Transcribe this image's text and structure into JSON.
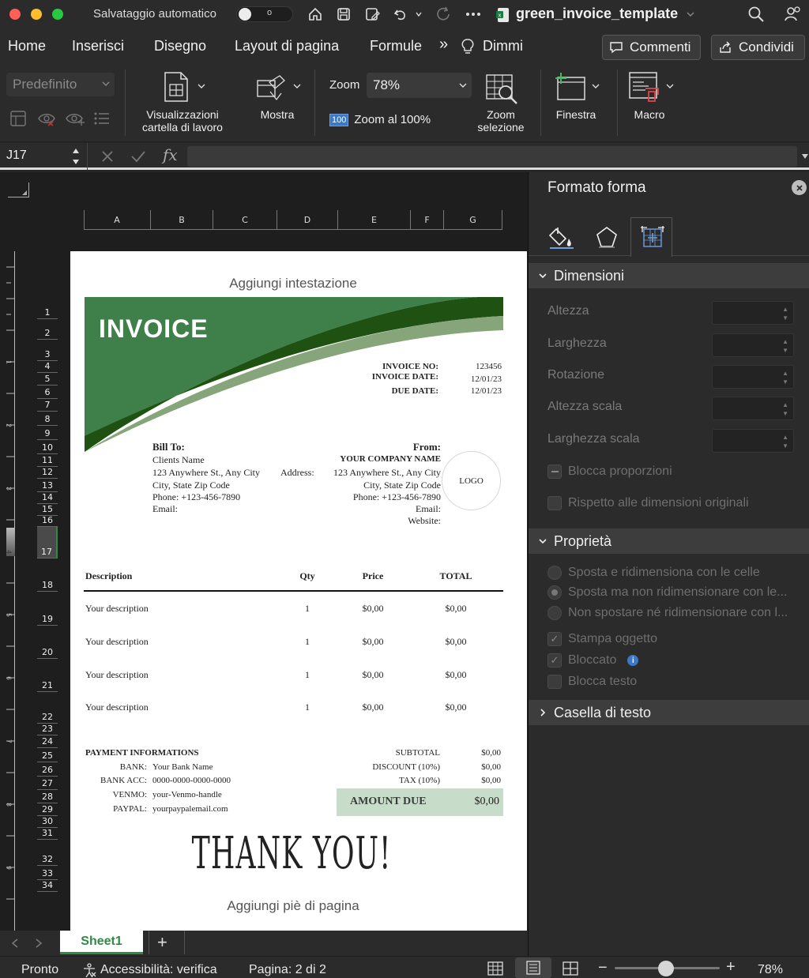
{
  "titlebar": {
    "autosave_label": "Salvataggio automatico",
    "autosave_state": "o",
    "document_title": "green_invoice_template"
  },
  "menubar": {
    "tabs": [
      "Home",
      "Inserisci",
      "Disegno",
      "Layout di pagina",
      "Formule",
      "Dimmi"
    ],
    "more": "»",
    "comments_label": "Commenti",
    "share_label": "Condividi"
  },
  "ribbon": {
    "style_value": "Predefinito",
    "views_label_1": "Visualizzazioni",
    "views_label_2": "cartella di lavoro",
    "show_label": "Mostra",
    "zoom_label": "Zoom",
    "zoom_value": "78%",
    "zoom100_icon_text": "100",
    "zoom100_label": "Zoom al 100%",
    "zoom_sel_1": "Zoom",
    "zoom_sel_2": "selezione",
    "window_label": "Finestra",
    "macro_label": "Macro"
  },
  "formulabar": {
    "cell_ref": "J17",
    "fx": "fx",
    "content": ""
  },
  "columns": [
    "A",
    "B",
    "C",
    "D",
    "E",
    "F",
    "G"
  ],
  "rows": [
    "1",
    "2",
    "3",
    "4",
    "5",
    "6",
    "7",
    "8",
    "9",
    "10",
    "11",
    "12",
    "13",
    "14",
    "15",
    "16",
    "17",
    "18",
    "19",
    "20",
    "21",
    "22",
    "23",
    "24",
    "25",
    "26",
    "27",
    "28",
    "29",
    "30",
    "31",
    "32",
    "33",
    "34"
  ],
  "ruler_numbers": [
    "1",
    "2",
    "3",
    "4",
    "5",
    "6",
    "7",
    "8",
    "9"
  ],
  "page": {
    "header_placeholder": "Aggiungi intestazione",
    "footer_placeholder": "Aggiungi piè di pagina",
    "banner_title": "INVOICE",
    "invoice_no_label": "INVOICE NO:",
    "invoice_no": "123456",
    "invoice_date_label": "INVOICE DATE:",
    "invoice_date": "12/01/23",
    "due_date_label": "DUE DATE:",
    "due_date": "12/01/23",
    "bill_to": {
      "label": "Bill To:",
      "name": "Clients Name",
      "street": "123 Anywhere St., Any City",
      "city": "City, State Zip Code",
      "phone": "Phone: +123-456-7890",
      "email": "Email:"
    },
    "from": {
      "label": "From:",
      "company": "YOUR COMPANY NAME",
      "address_label": "Address:",
      "street": "123 Anywhere St., Any City",
      "city": "City, State Zip Code",
      "phone": "Phone: +123-456-7890",
      "email": "Email:",
      "website": "Website:"
    },
    "logo_text": "LOGO",
    "table_headers": {
      "description": "Description",
      "qty": "Qty",
      "price": "Price",
      "total": "TOTAL"
    },
    "items": [
      {
        "description": "Your description",
        "qty": "1",
        "price": "$0,00",
        "total": "$0,00"
      },
      {
        "description": "Your description",
        "qty": "1",
        "price": "$0,00",
        "total": "$0,00"
      },
      {
        "description": "Your description",
        "qty": "1",
        "price": "$0,00",
        "total": "$0,00"
      },
      {
        "description": "Your description",
        "qty": "1",
        "price": "$0,00",
        "total": "$0,00"
      }
    ],
    "payment": {
      "title": "PAYMENT INFORMATIONS",
      "bank_label": "BANK:",
      "bank": "Your Bank Name",
      "acc_label": "BANK ACC:",
      "acc": "0000-0000-0000-0000",
      "venmo_label": "VENMO:",
      "venmo": "your-Venmo-handle",
      "paypal_label": "PAYPAL:",
      "paypal": "yourpaypalemail.com"
    },
    "totals": {
      "subtotal_label": "SUBTOTAL",
      "subtotal": "$0,00",
      "discount_label": "DISCOUNT  (10%)",
      "discount": "$0,00",
      "tax_label": "TAX  (10%)",
      "tax": "$0,00",
      "amount_due_label": "AMOUNT DUE",
      "amount_due": "$0,00"
    },
    "thank_you": "THANK YOU!"
  },
  "panel": {
    "title": "Formato forma",
    "dimensions_title": "Dimensioni",
    "dimension_fields": [
      "Altezza",
      "Larghezza",
      "Rotazione",
      "Altezza scala",
      "Larghezza scala"
    ],
    "lock_ratio": "Blocca proporzioni",
    "respect_original": "Rispetto alle dimensioni originali",
    "properties_title": "Proprietà",
    "radio_options": [
      "Sposta e ridimensiona con le celle",
      "Sposta ma non ridimensionare con le...",
      "Non spostare né ridimensionare con l..."
    ],
    "print_object": "Stampa oggetto",
    "locked": "Bloccato",
    "lock_text": "Blocca testo",
    "textbox_title": "Casella di testo"
  },
  "sheetbar": {
    "sheet_name": "Sheet1",
    "add": "+"
  },
  "statusbar": {
    "ready": "Pronto",
    "accessibility": "Accessibilità: verifica",
    "page": "Pagina: 2 di 2",
    "zoom": "78%",
    "zoom_slider_level": 0.49
  },
  "colors": {
    "banner_dark": "#1f5212",
    "banner_mid": "#3f7f49",
    "banner_light": "#87a57a",
    "amount_due_bg": "#c8ddc9",
    "sheet_tab": "#2f8a45"
  }
}
